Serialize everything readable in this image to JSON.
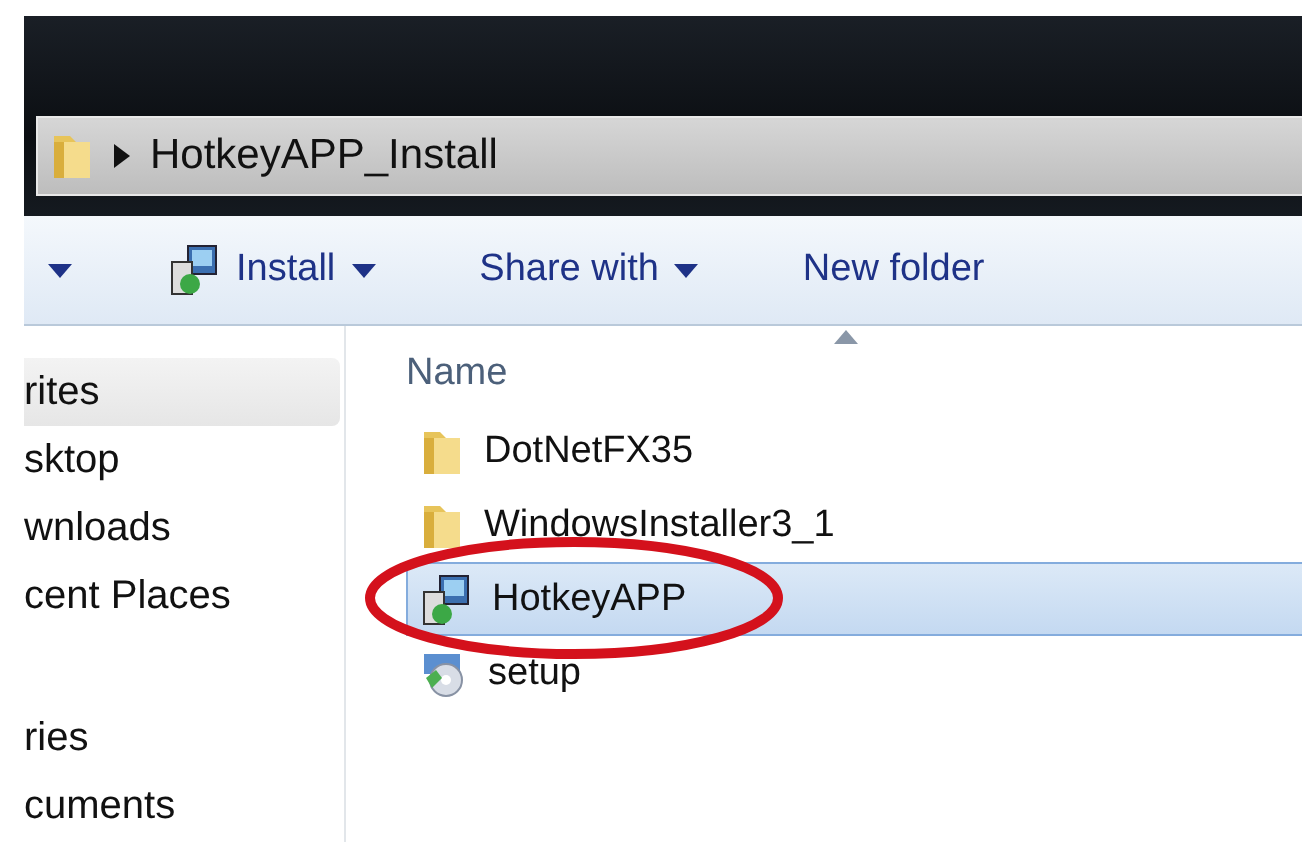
{
  "address_bar": {
    "path": "HotkeyAPP_Install"
  },
  "toolbar": [
    {
      "kind": "menu",
      "dropdown": true
    },
    {
      "kind": "installer",
      "label": "Install",
      "dropdown": true
    },
    {
      "kind": "text",
      "label": "Share with",
      "dropdown": true
    },
    {
      "kind": "text",
      "label": "New folder",
      "dropdown": false
    }
  ],
  "sidebar": {
    "groups": [
      {
        "items": [
          {
            "label": "rites",
            "selected": true
          },
          {
            "label": "sktop",
            "selected": false
          },
          {
            "label": "wnloads",
            "selected": false
          },
          {
            "label": "cent Places",
            "selected": false
          }
        ]
      },
      {
        "items": [
          {
            "label": "ries",
            "selected": false
          },
          {
            "label": "cuments",
            "selected": false
          }
        ]
      }
    ]
  },
  "file_list": {
    "column": "Name",
    "files": [
      {
        "name": "DotNetFX35",
        "kind": "folder",
        "selected": false,
        "circled": false
      },
      {
        "name": "WindowsInstaller3_1",
        "kind": "folder",
        "selected": false,
        "circled": false
      },
      {
        "name": "HotkeyAPP",
        "kind": "installer",
        "selected": true,
        "circled": true
      },
      {
        "name": "setup",
        "kind": "setup",
        "selected": false,
        "circled": false
      }
    ]
  }
}
